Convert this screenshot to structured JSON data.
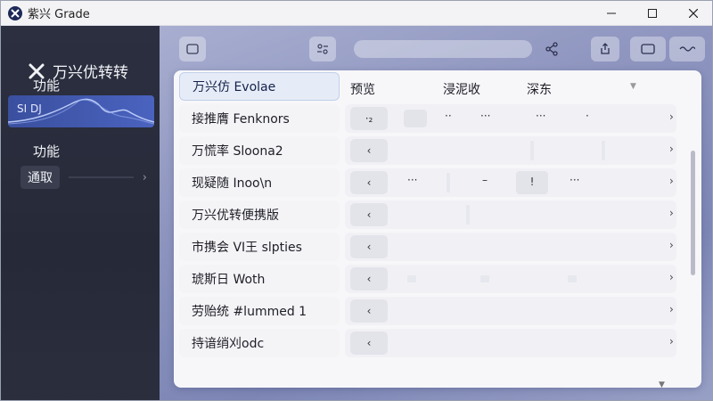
{
  "window": {
    "title": "紫兴 Grade",
    "controls": [
      "minimize",
      "maximize",
      "close"
    ]
  },
  "sidebar": {
    "brand": "万兴优转转",
    "section1": "功能",
    "card_label": "SI DJ",
    "section2": "功能",
    "select_label": "通取"
  },
  "toolbar": {
    "icons": [
      "window-icon",
      "settings-icon",
      "share-icon",
      "export-icon",
      "view-icon",
      "more-icon"
    ]
  },
  "table": {
    "headers": [
      "预览",
      "浸泥收",
      "深东"
    ],
    "rows": [
      {
        "name": "万兴仿 Evolae",
        "first": "",
        "cells": []
      },
      {
        "name": "接推膺 Fenknors",
        "first": "·₂",
        "cells": [
          "··",
          "···",
          "···",
          "·"
        ]
      },
      {
        "name": "万慌率 Sloona2",
        "first": "‹",
        "cells": []
      },
      {
        "name": "现疑随 Inoo\\n",
        "first": "‹",
        "cells": [
          "···",
          "–",
          "!",
          "···"
        ]
      },
      {
        "name": "万兴优转便携版",
        "first": "‹",
        "cells": []
      },
      {
        "name": "市携会 VI王 slpties",
        "first": "‹",
        "cells": []
      },
      {
        "name": "琥斯日 Woth",
        "first": "‹",
        "cells": []
      },
      {
        "name": "劳贻统 #lummed 1",
        "first": "‹",
        "cells": []
      },
      {
        "name": "持谙绡刈odc",
        "first": "‹",
        "cells": []
      }
    ]
  },
  "colors": {
    "sidebar_bg": "#2b2f40",
    "accent": "#4a63bf",
    "main_bg": "#8e95bf",
    "panel_bg": "#f7f7fa"
  }
}
